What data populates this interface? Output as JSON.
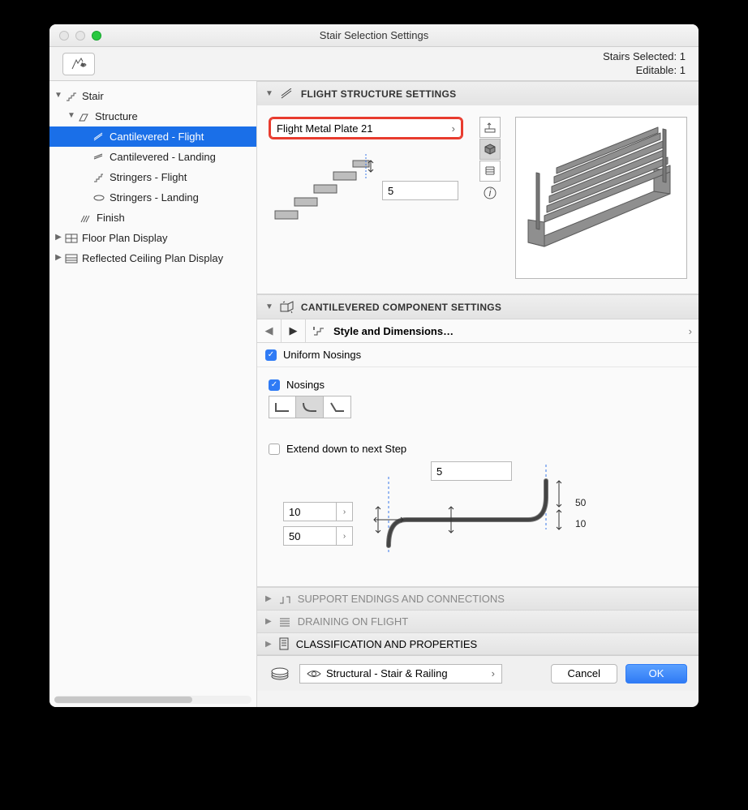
{
  "window": {
    "title": "Stair Selection Settings"
  },
  "status": {
    "selected": "Stairs Selected: 1",
    "editable": "Editable: 1"
  },
  "tree": {
    "stair": "Stair",
    "structure": "Structure",
    "cant_flight": "Cantilevered - Flight",
    "cant_landing": "Cantilevered - Landing",
    "str_flight": "Stringers - Flight",
    "str_landing": "Stringers - Landing",
    "finish": "Finish",
    "floorplan": "Floor Plan Display",
    "rcp": "Reflected Ceiling Plan Display"
  },
  "panels": {
    "flight": {
      "title": "FLIGHT STRUCTURE SETTINGS"
    },
    "cantilever": {
      "title": "CANTILEVERED COMPONENT SETTINGS"
    },
    "support": {
      "title": "SUPPORT ENDINGS AND CONNECTIONS"
    },
    "drain": {
      "title": "DRAINING ON FLIGHT"
    },
    "classif": {
      "title": "CLASSIFICATION AND PROPERTIES"
    }
  },
  "flight": {
    "component": "Flight Metal Plate 21",
    "thickness": "5"
  },
  "subnav": {
    "label": "Style and Dimensions…"
  },
  "uniform": {
    "label": "Uniform Nosings"
  },
  "nosings": {
    "label": "Nosings"
  },
  "extend": {
    "label": "Extend down to next Step"
  },
  "dims": {
    "top": "5",
    "a": "10",
    "b": "50",
    "right_top": "50",
    "right_bot": "10"
  },
  "footer": {
    "layer": "Structural - Stair & Railing",
    "cancel": "Cancel",
    "ok": "OK"
  }
}
